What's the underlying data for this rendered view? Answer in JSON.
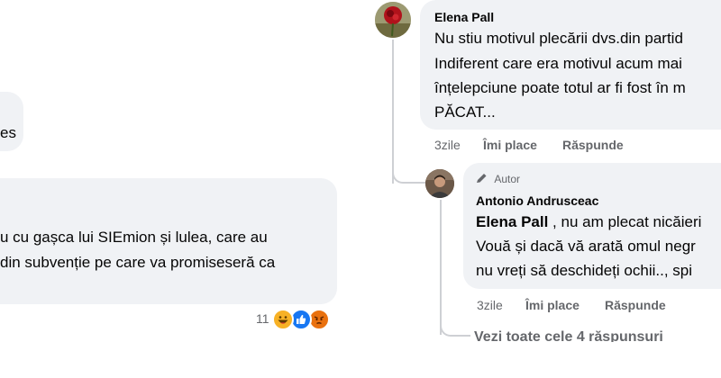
{
  "left": {
    "bubble1_partial": "es",
    "bubble2_lines": [
      "u cu gașca lui SIEmion și lulea, care au",
      "din subvenție pe care va promiseseră ca"
    ],
    "reactions": {
      "count": "11",
      "icons": [
        "haha-icon",
        "like-icon",
        "angry-icon"
      ]
    }
  },
  "right": {
    "comment1": {
      "author": "Elena Pall",
      "lines": [
        "Nu stiu motivul plecării dvs.din partid",
        "Indiferent care era motivul acum mai",
        "înțelepciune poate totul ar fi fost în m",
        "PĂCAT..."
      ],
      "time": "3zile",
      "like": "Îmi place",
      "reply": "Răspunde"
    },
    "comment2": {
      "badge": "Autor",
      "author": "Antonio Andrusceac",
      "mention": "Elena Pall",
      "first_line_rest": " , nu am plecat nicăieri",
      "lines": [
        "Vouă și dacă vă arată omul negr",
        "nu vreți să deschideți ochii.., spi"
      ],
      "time": "3zile",
      "like": "Îmi place",
      "reply": "Răspunde"
    },
    "view_replies": "Vezi toate cele 4 răspunsuri"
  },
  "colors": {
    "bubble": "#f0f2f5",
    "meta": "#65676b",
    "like_blue": "#1877f2",
    "angry": "#e9710f",
    "haha": "#f7b125"
  }
}
